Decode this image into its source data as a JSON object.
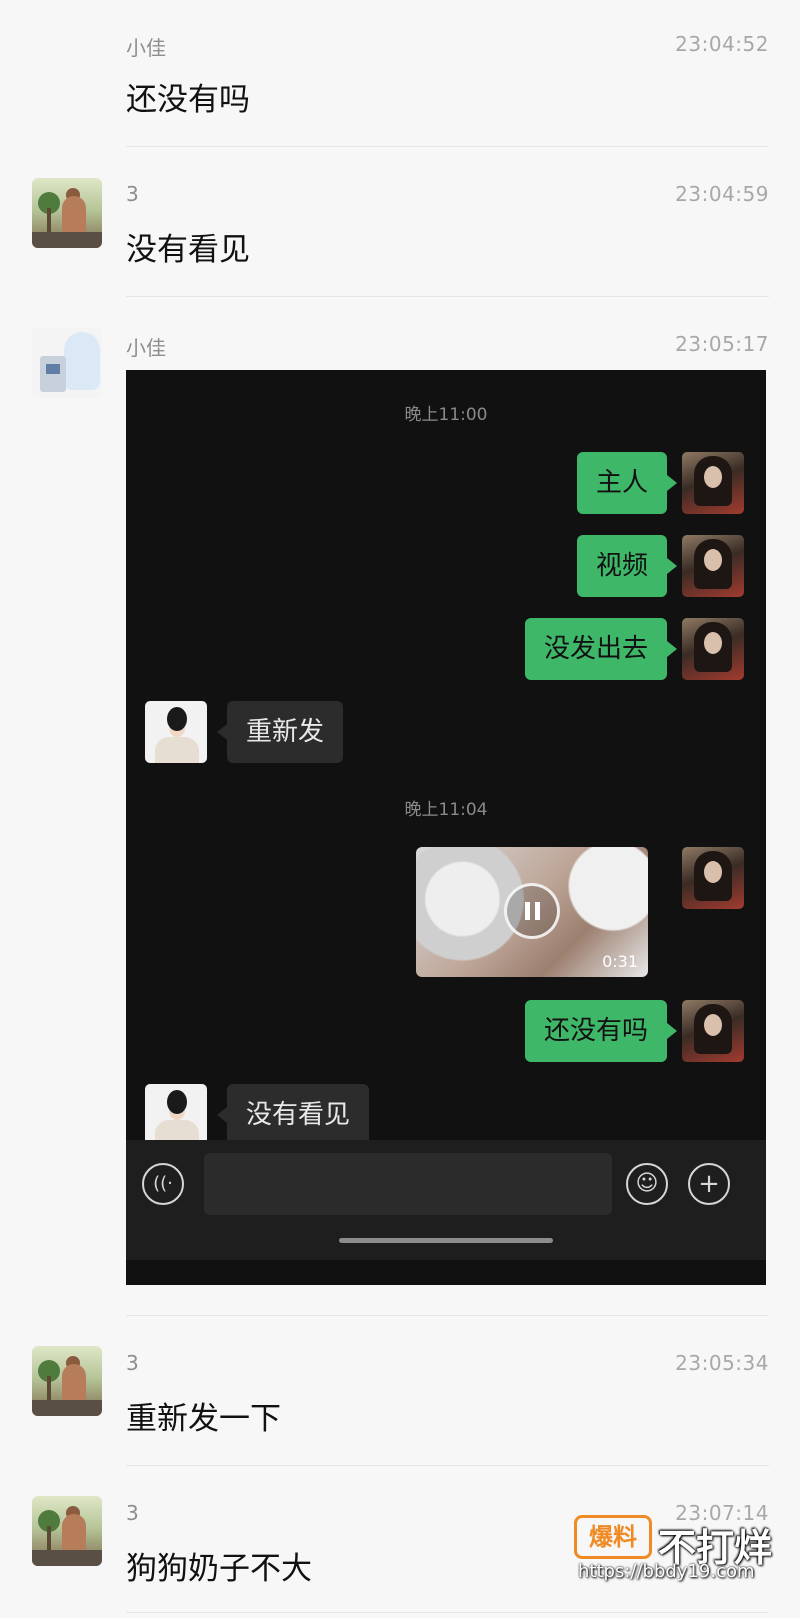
{
  "messages": [
    {
      "sender": "小佳",
      "time": "23:04:52",
      "text": "还没有吗"
    },
    {
      "sender": "3",
      "time": "23:04:59",
      "text": "没有看见"
    },
    {
      "sender": "小佳",
      "time": "23:05:17"
    },
    {
      "sender": "3",
      "time": "23:05:34",
      "text": "重新发一下"
    },
    {
      "sender": "3",
      "time": "23:07:14",
      "text": "狗狗奶子不大"
    }
  ],
  "shot": {
    "time1": "晚上11:00",
    "time2": "晚上11:04",
    "bubbles": [
      "主人",
      "视频",
      "没发出去",
      "重新发",
      "还没有吗",
      "没有看见"
    ],
    "video_duration": "0:31"
  },
  "icons": {
    "voice": "voice-icon",
    "emoji": "emoji-icon",
    "plus": "plus-icon"
  },
  "watermark": {
    "logo": "爆料",
    "title": "不打烊",
    "url": "https://bbdy19.com"
  },
  "colors": {
    "green_bubble": "#3fb769",
    "dark_bg": "#111111",
    "watermark_orange": "#f08a24"
  }
}
